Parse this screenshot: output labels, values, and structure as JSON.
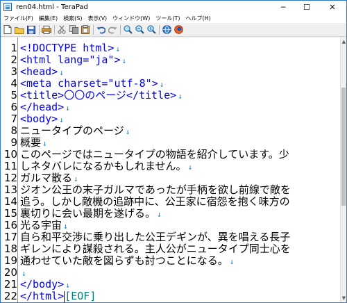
{
  "window": {
    "title": "ren04.html - TeraPad",
    "minimize_glyph": "─",
    "maximize_glyph": "☐",
    "close_glyph": "✕"
  },
  "menu": [
    "ファイル(F)",
    "編集(E)",
    "検索(S)",
    "表示(V)",
    "ウィンドウ(W)",
    "ツール(T)",
    "ヘルプ(H)"
  ],
  "toolbar_icons": [
    "new-file-icon",
    "open-folder-icon",
    "save-icon",
    "print-icon",
    "cut-icon",
    "copy-icon",
    "paste-icon",
    "undo-icon",
    "redo-icon",
    "find-icon",
    "find-next-icon",
    "find-previous-icon",
    "web-icon",
    "firefox-icon"
  ],
  "editor": {
    "lines": [
      {
        "n": "1",
        "t": "<!DOCTYPE html>",
        "tag": true,
        "eol": "↓"
      },
      {
        "n": "2",
        "t": "<html lang=\"ja\">",
        "tag": true,
        "eol": "↓"
      },
      {
        "n": "3",
        "t": "<head>",
        "tag": true,
        "eol": "↓"
      },
      {
        "n": "4",
        "t": "<meta charset=\"utf-8\">",
        "tag": true,
        "eol": "↓"
      },
      {
        "n": "5",
        "t": "<title>〇〇のページ</title>",
        "tag": true,
        "eol": "↓"
      },
      {
        "n": "6",
        "t": "</head>",
        "tag": true,
        "eol": "↓"
      },
      {
        "n": "7",
        "t": "<body>",
        "tag": true,
        "eol": "↓"
      },
      {
        "n": "8",
        "t": "ニュータイプのページ",
        "tag": false,
        "eol": "↓"
      },
      {
        "n": "9",
        "t": "概要",
        "tag": false,
        "eol": "↓"
      },
      {
        "n": "10",
        "t": "このページではニュータイプの物語を紹介しています。少",
        "tag": false,
        "eol": ""
      },
      {
        "n": "11",
        "t": "しネタバレになるかもしれません。",
        "tag": false,
        "eol": "↓"
      },
      {
        "n": "12",
        "t": "ガルマ散る",
        "tag": false,
        "eol": "↓"
      },
      {
        "n": "13",
        "t": "ジオン公王の末子ガルマであったが手柄を欲し前線で敵を",
        "tag": false,
        "eol": ""
      },
      {
        "n": "14",
        "t": "追う。しかし敵機の追跡中に、公王家に宿怨を抱く味方の",
        "tag": false,
        "eol": ""
      },
      {
        "n": "15",
        "t": "裏切りに会い最期を遂げる。",
        "tag": false,
        "eol": "↓"
      },
      {
        "n": "16",
        "t": "光る宇宙",
        "tag": false,
        "eol": "↓"
      },
      {
        "n": "17",
        "t": "自ら和平交渉に乗り出した公王デギンが、異を唱える長子",
        "tag": false,
        "eol": ""
      },
      {
        "n": "18",
        "t": "ギレンにより謀殺される。主人公がニュータイプ同士心を",
        "tag": false,
        "eol": ""
      },
      {
        "n": "19",
        "t": "通わせていた敵を図らずも討つことになる。",
        "tag": false,
        "eol": "↓"
      },
      {
        "n": "20",
        "t": "",
        "tag": false,
        "eol": "↓"
      },
      {
        "n": "21",
        "t": "</body>",
        "tag": true,
        "eol": "↓"
      },
      {
        "n": "22",
        "t": "</html>",
        "tag": true,
        "eol": "",
        "eof": "[EOF]"
      }
    ]
  }
}
